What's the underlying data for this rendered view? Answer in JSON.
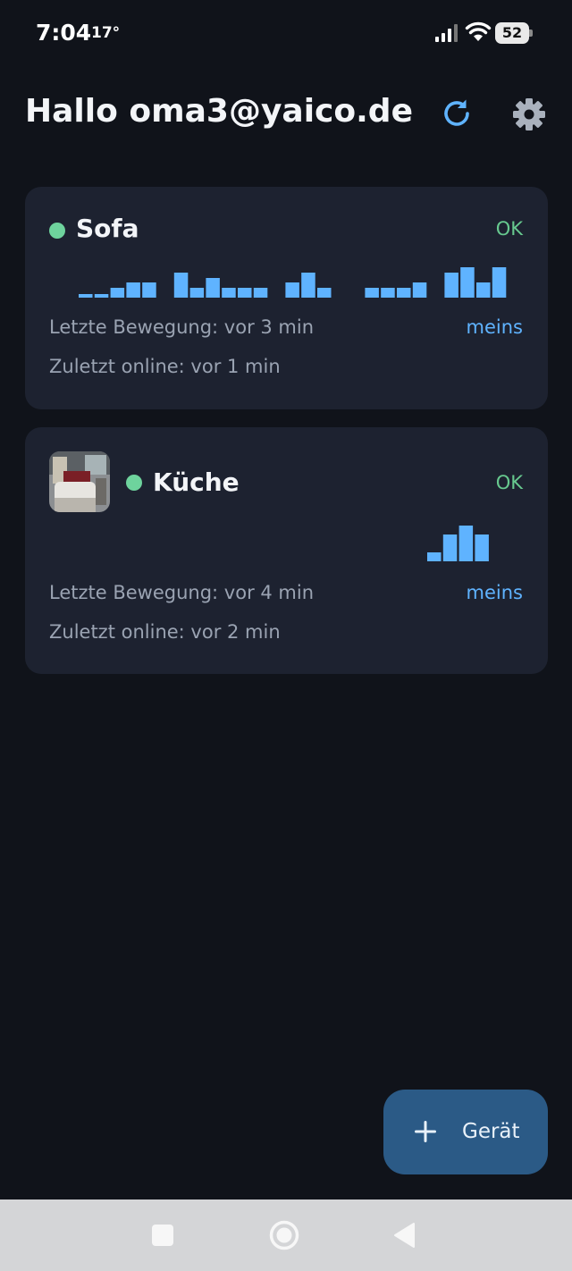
{
  "status_bar": {
    "time": "7:04",
    "temperature": "17°",
    "battery_level": "52"
  },
  "header": {
    "greeting": "Hallo oma3@yaico.de",
    "refresh_icon": "refresh-icon",
    "settings_icon": "gear-icon"
  },
  "devices": [
    {
      "name": "Sofa",
      "status": "OK",
      "online_color": "#6ed39d",
      "last_motion": "Letzte Bewegung: vor 3 min",
      "last_online": "Zuletzt online: vor 1 min",
      "owner": "meins",
      "activity_levels": [
        0.15,
        0.15,
        0.4,
        0.6,
        0.6,
        0,
        1.0,
        0.4,
        0.8,
        0.4,
        0.4,
        0.4,
        0,
        0.6,
        1.0,
        0.4,
        0,
        0,
        0.4,
        0.4,
        0.4,
        0.6,
        0,
        1.0,
        1.2,
        0.6,
        1.2
      ]
    },
    {
      "name": "Küche",
      "status": "OK",
      "online_color": "#6ed39d",
      "has_photo": true,
      "last_motion": "Letzte Bewegung: vor 4 min",
      "last_online": "Zuletzt online: vor 2 min",
      "owner": "meins",
      "activity_levels": [
        0.25,
        0.75,
        1.0,
        0.75
      ]
    }
  ],
  "fab": {
    "label": "Gerät",
    "icon": "plus-icon"
  },
  "nav": {
    "recents_icon": "square-icon",
    "home_icon": "circle-icon",
    "back_icon": "triangle-back-icon"
  }
}
